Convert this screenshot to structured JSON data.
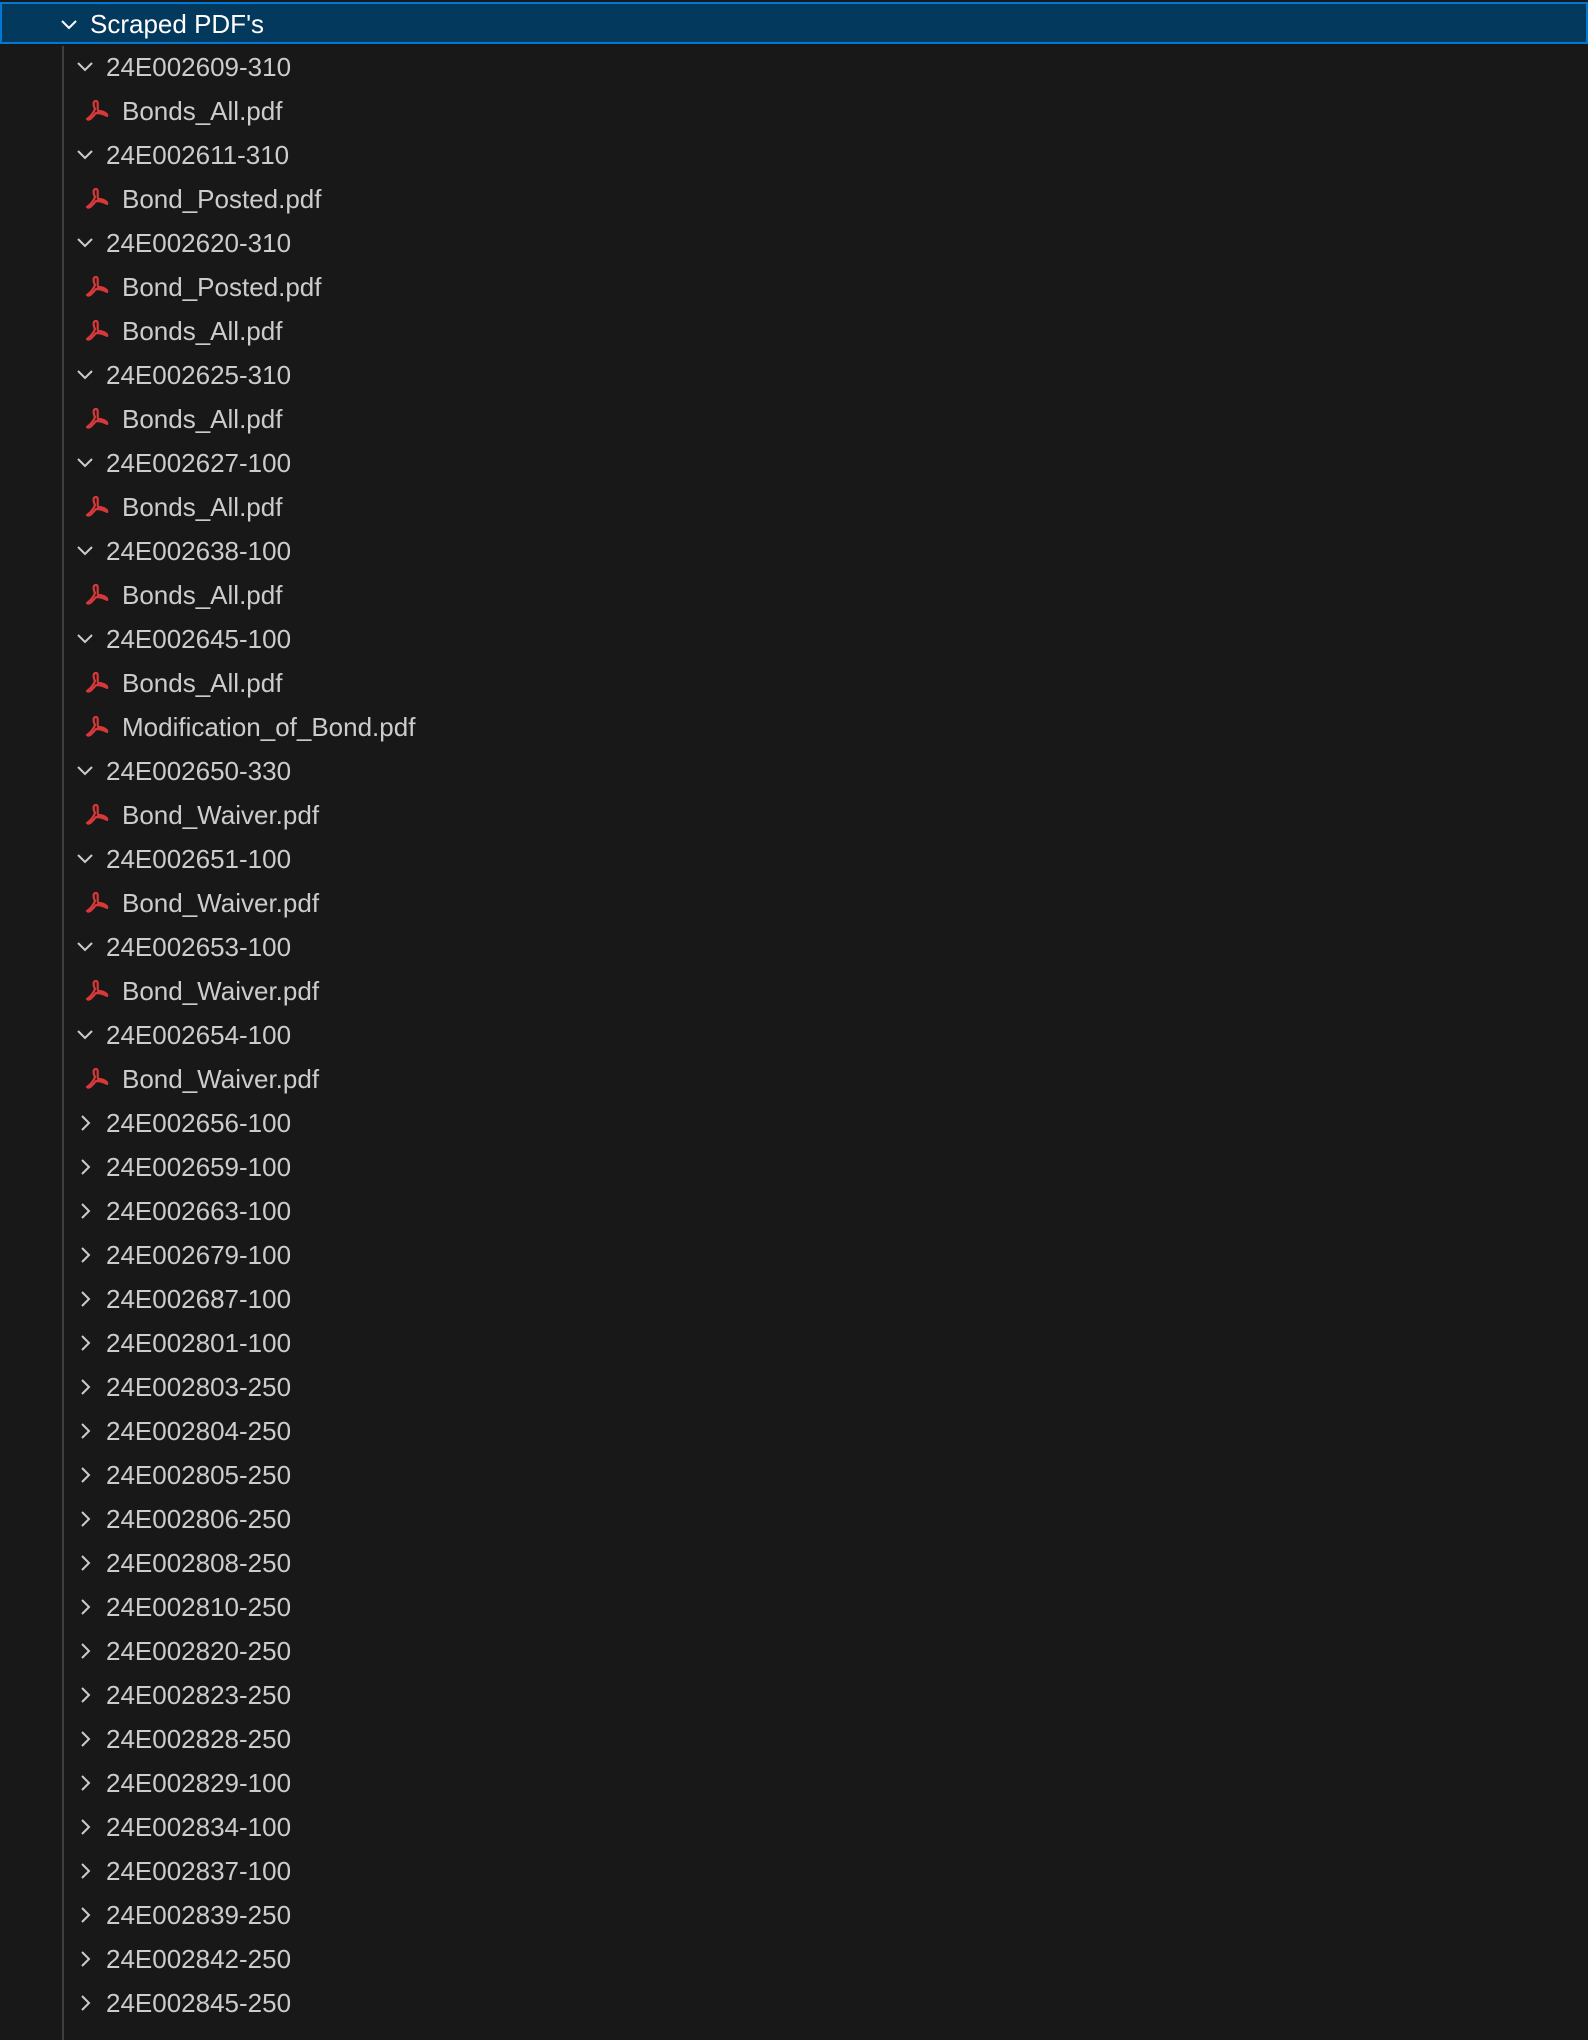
{
  "explorer": {
    "root": {
      "label": "Scraped PDF's",
      "expanded": true
    },
    "colors": {
      "background": "#181818",
      "selection_background": "#04395e",
      "selection_border": "#0078d4",
      "text": "#cccccc",
      "pdf_icon": "#d9383a"
    },
    "items": [
      {
        "type": "folder",
        "label": "24E002609-310",
        "expanded": true
      },
      {
        "type": "file",
        "label": "Bonds_All.pdf",
        "icon": "pdf-icon"
      },
      {
        "type": "folder",
        "label": "24E002611-310",
        "expanded": true
      },
      {
        "type": "file",
        "label": "Bond_Posted.pdf",
        "icon": "pdf-icon"
      },
      {
        "type": "folder",
        "label": "24E002620-310",
        "expanded": true
      },
      {
        "type": "file",
        "label": "Bond_Posted.pdf",
        "icon": "pdf-icon"
      },
      {
        "type": "file",
        "label": "Bonds_All.pdf",
        "icon": "pdf-icon"
      },
      {
        "type": "folder",
        "label": "24E002625-310",
        "expanded": true
      },
      {
        "type": "file",
        "label": "Bonds_All.pdf",
        "icon": "pdf-icon"
      },
      {
        "type": "folder",
        "label": "24E002627-100",
        "expanded": true
      },
      {
        "type": "file",
        "label": "Bonds_All.pdf",
        "icon": "pdf-icon"
      },
      {
        "type": "folder",
        "label": "24E002638-100",
        "expanded": true
      },
      {
        "type": "file",
        "label": "Bonds_All.pdf",
        "icon": "pdf-icon"
      },
      {
        "type": "folder",
        "label": "24E002645-100",
        "expanded": true
      },
      {
        "type": "file",
        "label": "Bonds_All.pdf",
        "icon": "pdf-icon"
      },
      {
        "type": "file",
        "label": "Modification_of_Bond.pdf",
        "icon": "pdf-icon"
      },
      {
        "type": "folder",
        "label": "24E002650-330",
        "expanded": true
      },
      {
        "type": "file",
        "label": "Bond_Waiver.pdf",
        "icon": "pdf-icon"
      },
      {
        "type": "folder",
        "label": "24E002651-100",
        "expanded": true
      },
      {
        "type": "file",
        "label": "Bond_Waiver.pdf",
        "icon": "pdf-icon"
      },
      {
        "type": "folder",
        "label": "24E002653-100",
        "expanded": true
      },
      {
        "type": "file",
        "label": "Bond_Waiver.pdf",
        "icon": "pdf-icon"
      },
      {
        "type": "folder",
        "label": "24E002654-100",
        "expanded": true
      },
      {
        "type": "file",
        "label": "Bond_Waiver.pdf",
        "icon": "pdf-icon"
      },
      {
        "type": "folder",
        "label": "24E002656-100",
        "expanded": false
      },
      {
        "type": "folder",
        "label": "24E002659-100",
        "expanded": false
      },
      {
        "type": "folder",
        "label": "24E002663-100",
        "expanded": false
      },
      {
        "type": "folder",
        "label": "24E002679-100",
        "expanded": false
      },
      {
        "type": "folder",
        "label": "24E002687-100",
        "expanded": false
      },
      {
        "type": "folder",
        "label": "24E002801-100",
        "expanded": false
      },
      {
        "type": "folder",
        "label": "24E002803-250",
        "expanded": false
      },
      {
        "type": "folder",
        "label": "24E002804-250",
        "expanded": false
      },
      {
        "type": "folder",
        "label": "24E002805-250",
        "expanded": false
      },
      {
        "type": "folder",
        "label": "24E002806-250",
        "expanded": false
      },
      {
        "type": "folder",
        "label": "24E002808-250",
        "expanded": false
      },
      {
        "type": "folder",
        "label": "24E002810-250",
        "expanded": false
      },
      {
        "type": "folder",
        "label": "24E002820-250",
        "expanded": false
      },
      {
        "type": "folder",
        "label": "24E002823-250",
        "expanded": false
      },
      {
        "type": "folder",
        "label": "24E002828-250",
        "expanded": false
      },
      {
        "type": "folder",
        "label": "24E002829-100",
        "expanded": false
      },
      {
        "type": "folder",
        "label": "24E002834-100",
        "expanded": false
      },
      {
        "type": "folder",
        "label": "24E002837-100",
        "expanded": false
      },
      {
        "type": "folder",
        "label": "24E002839-250",
        "expanded": false
      },
      {
        "type": "folder",
        "label": "24E002842-250",
        "expanded": false
      },
      {
        "type": "folder",
        "label": "24E002845-250",
        "expanded": false
      }
    ]
  }
}
